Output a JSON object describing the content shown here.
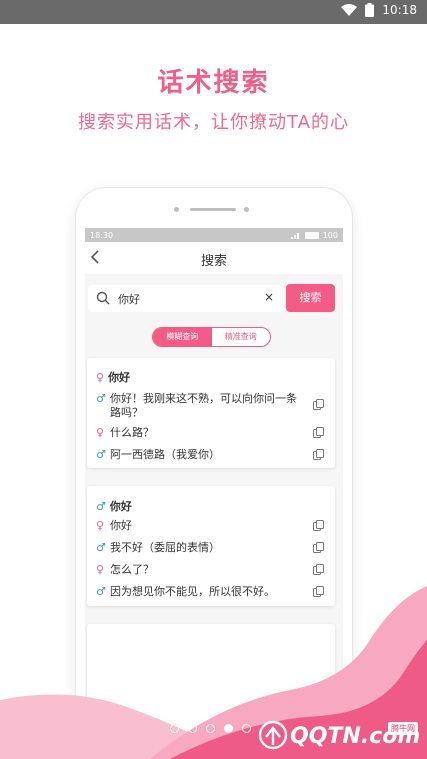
{
  "status_bar": {
    "time": "10:18"
  },
  "promo": {
    "title": "话术搜索",
    "subtitle": "搜索实用话术，让你撩动TA的心"
  },
  "device": {
    "status": {
      "time": "18:30",
      "battery": "100"
    },
    "nav": {
      "back_icon": "chevron-left-icon",
      "title": "搜索"
    },
    "search": {
      "value": "你好",
      "clear_symbol": "×",
      "button": "搜索"
    },
    "mode_toggle": {
      "options": [
        "模糊查询",
        "精准查询"
      ],
      "selected": "模糊查询"
    },
    "results": [
      {
        "head_gender": "female",
        "head": "你好",
        "lines": [
          {
            "gender": "male",
            "text": "你好！我刚来这不熟，可以向你问一条路吗？"
          },
          {
            "gender": "female",
            "text": "什么路？"
          },
          {
            "gender": "male",
            "text": "阿一西德路（我爱你）"
          }
        ]
      },
      {
        "head_gender": "male",
        "head": "你好",
        "lines": [
          {
            "gender": "female",
            "text": "你好"
          },
          {
            "gender": "male",
            "text": "我不好（委屈的表情）"
          },
          {
            "gender": "female",
            "text": "怎么了？"
          },
          {
            "gender": "male",
            "text": "因为想见你不能见，所以很不好。"
          }
        ]
      }
    ]
  },
  "pager": {
    "count": 6,
    "active_index": 3
  },
  "watermark": {
    "brand": "QQTN.com",
    "tag": "腾牛网"
  },
  "colors": {
    "accent": "#f25c86",
    "male": "#3d93d4",
    "female": "#f25c86",
    "status_bar": "#6a6a6a"
  }
}
